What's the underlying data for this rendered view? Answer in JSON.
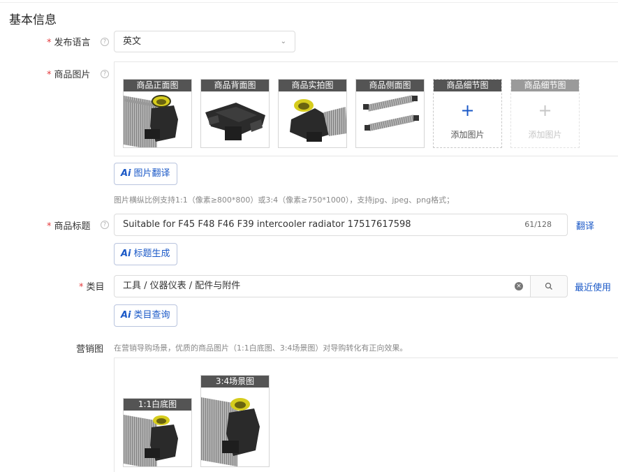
{
  "section_title": "基本信息",
  "colors": {
    "accent": "#1a58c7",
    "required": "#e4393c",
    "caption_bg": "#545454"
  },
  "language": {
    "label": "发布语言",
    "required_mark": "*",
    "help_icon": "?",
    "value": "英文",
    "chevron_icon": "chevron-down-icon"
  },
  "images": {
    "label": "商品图片",
    "required_mark": "*",
    "help_icon": "?",
    "thumbs": [
      {
        "caption": "商品正面图",
        "picture": "intercooler-front"
      },
      {
        "caption": "商品背面图",
        "picture": "intercooler-back"
      },
      {
        "caption": "商品实拍图",
        "picture": "intercooler-real"
      },
      {
        "caption": "商品侧面图",
        "picture": "intercooler-side"
      }
    ],
    "add_slots": [
      {
        "caption": "商品细节图",
        "plus": "+",
        "text": "添加图片",
        "enabled": true
      },
      {
        "caption": "商品细节图",
        "plus": "+",
        "text": "添加图片",
        "enabled": false
      }
    ],
    "ai_button": {
      "mark": "Ai",
      "label": "图片翻译"
    },
    "hint": "图片横纵比例支持1:1（像素≥800*800）或3:4（像素≥750*1000），支持jpg、jpeg、png格式；"
  },
  "title": {
    "label": "商品标题",
    "required_mark": "*",
    "help_icon": "?",
    "value": "Suitable for F45 F48 F46 F39 intercooler radiator 17517617598",
    "counter": "61/128",
    "translate_link": "翻译",
    "ai_button": {
      "mark": "Ai",
      "label": "标题生成"
    }
  },
  "category": {
    "label": "类目",
    "required_mark": "*",
    "value": "工具 / 仪器仪表 / 配件与附件",
    "clear_icon": "×",
    "search_icon": "search-icon",
    "recent_link": "最近使用",
    "ai_button": {
      "mark": "Ai",
      "label": "类目查询"
    }
  },
  "marketing": {
    "label": "营销图",
    "hint": "在营销导购场景，优质的商品图片（1:1白底图、3:4场景图）对导购转化有正向效果。",
    "thumbs": [
      {
        "caption": "1:1白底图",
        "picture": "intercooler-front"
      },
      {
        "caption": "3:4场景图",
        "picture": "intercooler-front"
      }
    ]
  }
}
